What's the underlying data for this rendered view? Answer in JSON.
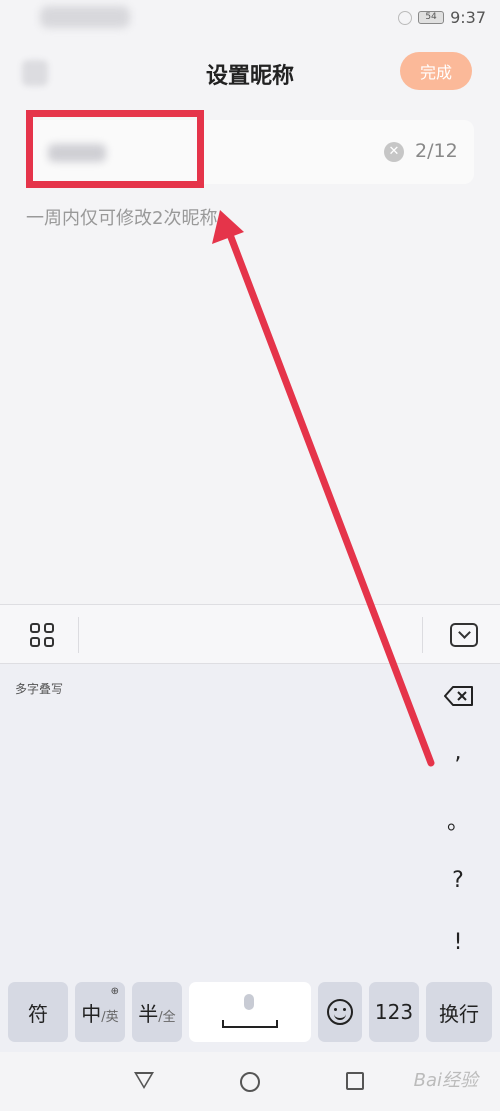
{
  "status_bar": {
    "time": "9:37",
    "battery": "54"
  },
  "header": {
    "title": "设置昵称",
    "done_label": "完成"
  },
  "nickname_field": {
    "char_count": "2/12"
  },
  "hint": "一周内仅可修改2次昵称",
  "keyboard": {
    "handwriting_label": "多字叠写",
    "punctuation": [
      ",",
      "。",
      "?",
      "!"
    ],
    "keys": {
      "symbols": "符",
      "chinese": "中",
      "english_sub": "/英",
      "half": "半",
      "full_sub": "/全",
      "numbers": "123",
      "enter": "换行"
    }
  },
  "watermark": "Bai经验",
  "colors": {
    "accent": "#fbb999",
    "annotation": "#e5344a"
  }
}
